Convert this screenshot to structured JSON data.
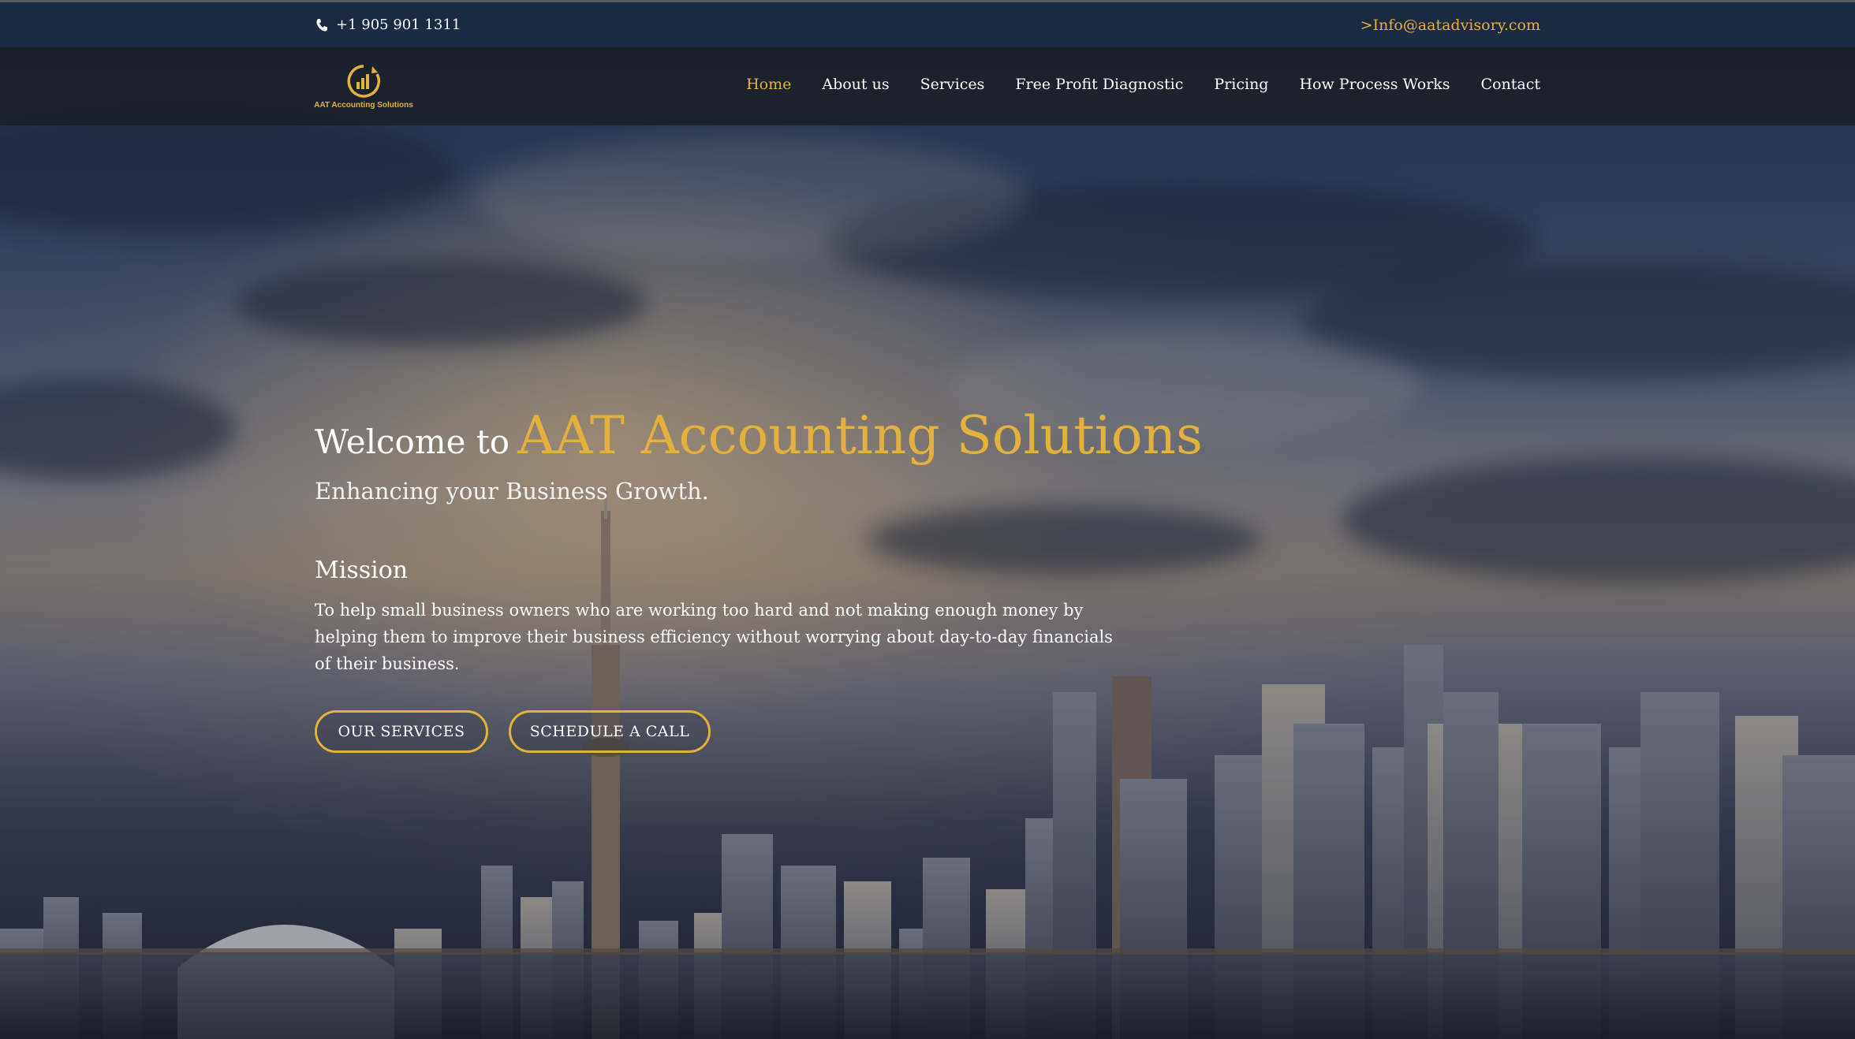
{
  "topbar": {
    "phone": "+1 905 901 1311",
    "phone_icon": "phone-icon",
    "email": ">Info@aatadvisory.com"
  },
  "logo": {
    "text": "AAT Accounting Solutions",
    "icon": "bar-chart-circle-icon"
  },
  "nav": {
    "items": [
      {
        "label": "Home",
        "active": true
      },
      {
        "label": "About us",
        "active": false
      },
      {
        "label": "Services",
        "active": false
      },
      {
        "label": "Free Profit Diagnostic",
        "active": false
      },
      {
        "label": "Pricing",
        "active": false
      },
      {
        "label": "How Process Works",
        "active": false
      },
      {
        "label": "Contact",
        "active": false
      }
    ]
  },
  "hero": {
    "welcome": "Welcome to",
    "brand": "AAT Accounting Solutions",
    "tagline": "Enhancing your Business Growth.",
    "mission_title": "Mission",
    "mission_text": "To help small business owners who are working too hard and not making enough money by helping them to improve their business efficiency without worrying about day-to-day financials of their business.",
    "buttons": {
      "services": "OUR SERVICES",
      "call": "SCHEDULE A CALL"
    }
  },
  "colors": {
    "accent": "#e3b23c",
    "nav_bg": "#1a1f27",
    "text": "#ffffff"
  }
}
